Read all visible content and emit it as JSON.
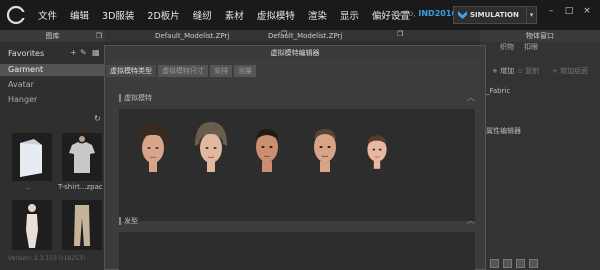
{
  "menubar": {
    "items": [
      "文件",
      "编辑",
      "3D服装",
      "2D板片",
      "缝纫",
      "素材",
      "虚拟模特",
      "渲染",
      "显示",
      "偏好设置"
    ],
    "hello_prefix": "Hello,",
    "hello_user": "IND2016",
    "simulation_label": "SIMULATION"
  },
  "library": {
    "title": "图库",
    "favorites_label": "Favorites",
    "items": [
      "Garment",
      "Avatar",
      "Hanger"
    ],
    "tiles": [
      {
        "label": ".."
      },
      {
        "label": "T-shirt...zpac"
      }
    ],
    "version": "Version: 2.3.153 (r18253)"
  },
  "document_tabs": [
    "Default_Modelist.ZPrj",
    "Default_Modelist.ZPrj"
  ],
  "dialog": {
    "title": "虚拟模特编辑器",
    "tabs": [
      "虚拟模特类型",
      "虚拟模特尺寸",
      "安排",
      "测量"
    ],
    "sections": {
      "avatar": "虚拟模特",
      "hair": "发型"
    },
    "faces": [
      "female-avatar-1",
      "female-avatar-2",
      "male-avatar-1",
      "male-avatar-2",
      "child-avatar"
    ]
  },
  "right_panel": {
    "title": "物体窗口",
    "tabs": [
      "织物",
      "扣眼"
    ],
    "add_label": "增加",
    "copy_label": "复制",
    "add_group_label": "增加组面",
    "fabric_label": "_Fabric",
    "property_editor": "属性编辑器"
  },
  "colors": {
    "accent": "#3aa0e8",
    "menubar_bg": "#1a1a1a",
    "panel_bg": "#2f2f2f",
    "dialog_bg": "#3c3c3c"
  }
}
